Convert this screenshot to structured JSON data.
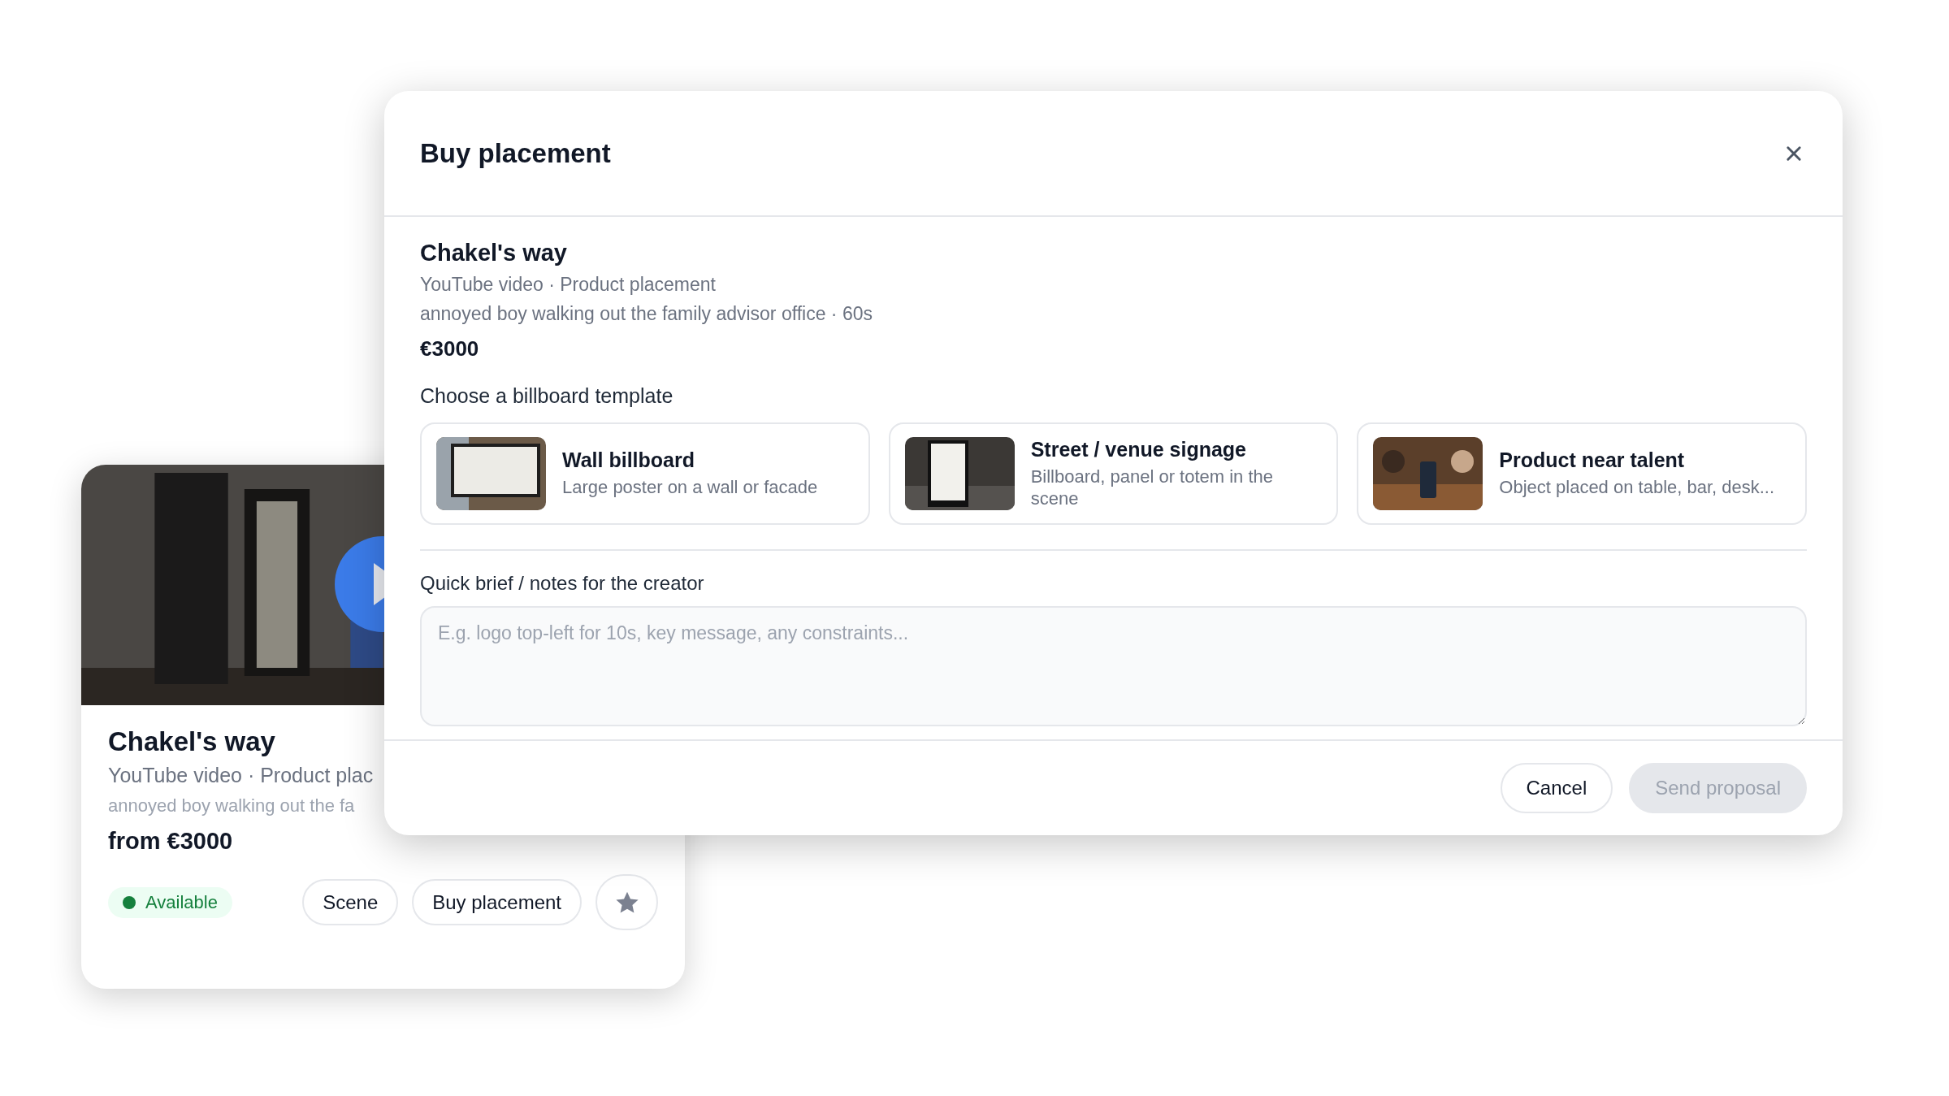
{
  "card": {
    "title": "Chakel's way",
    "subtitle": "YouTube video · Product plac",
    "description": "annoyed boy walking out the fa",
    "price": "from €3000",
    "status": "Available",
    "buttons": [
      {
        "label": "Scene"
      },
      {
        "label": "Buy placement"
      }
    ]
  },
  "modal": {
    "title": "Buy placement",
    "item": {
      "title": "Chakel's way",
      "subtitle": "YouTube video · Product placement",
      "description": "annoyed boy walking out the family advisor office · 60s",
      "price": "€3000"
    },
    "templates_heading": "Choose a billboard template",
    "templates": [
      {
        "kind": "wall",
        "title": "Wall billboard",
        "description": "Large poster on a wall or facade",
        "selected": false
      },
      {
        "kind": "street",
        "title": "Street / venue signage",
        "description": "Billboard, panel or totem in the scene",
        "selected": false
      },
      {
        "kind": "product",
        "title": "Product near talent",
        "description": "Object placed on table, bar, desk...",
        "selected": false
      }
    ],
    "brief": {
      "label": "Quick brief / notes for the creator",
      "placeholder": "E.g. logo top-left for 10s, key message, any constraints..."
    },
    "buttons": [
      {
        "label": "Cancel",
        "disabled": false
      },
      {
        "label": "Send proposal",
        "disabled": true
      }
    ]
  }
}
